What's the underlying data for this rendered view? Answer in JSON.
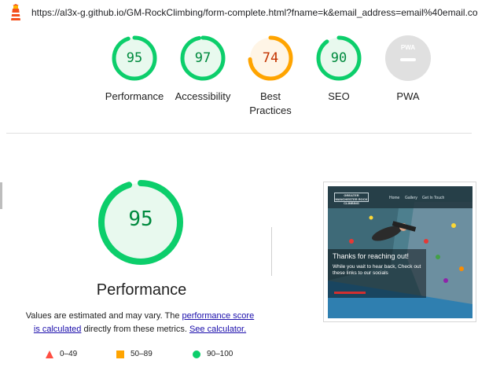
{
  "browser": {
    "url": "https://al3x-g.github.io/GM-RockClimbing/form-complete.html?fname=k&email_address=email%40email.com"
  },
  "categories": [
    {
      "key": "performance",
      "label": "Performance",
      "score": "95",
      "fraction": 0.95,
      "color": "#0cce6b",
      "text_color": "#008a3e",
      "fill": "#e8f9ee"
    },
    {
      "key": "accessibility",
      "label": "Accessibility",
      "score": "97",
      "fraction": 0.97,
      "color": "#0cce6b",
      "text_color": "#008a3e",
      "fill": "#e8f9ee"
    },
    {
      "key": "best-practices",
      "label_line1": "Best",
      "label_line2": "Practices",
      "score": "74",
      "fraction": 0.74,
      "color": "#ffa400",
      "text_color": "#c33300",
      "fill": "#fff5e6"
    },
    {
      "key": "seo",
      "label": "SEO",
      "score": "90",
      "fraction": 0.9,
      "color": "#0cce6b",
      "text_color": "#008a3e",
      "fill": "#e8f9ee"
    },
    {
      "key": "pwa",
      "label": "PWA",
      "badge": "PWA",
      "fill": "#e0e0e0"
    }
  ],
  "summary": {
    "score": "95",
    "fraction": 0.95,
    "title": "Performance",
    "note_prefix": "Values are estimated and may vary. The ",
    "link_score": "performance score is calculated",
    "note_middle": " directly from these metrics. ",
    "link_calculator": "See calculator."
  },
  "legend": [
    {
      "range": "0–49",
      "shape": "triangle",
      "color": "#ff4e42"
    },
    {
      "range": "50–89",
      "shape": "square",
      "color": "#ffa400"
    },
    {
      "range": "90–100",
      "shape": "circle",
      "color": "#0cce6b"
    }
  ],
  "screenshot": {
    "logo_text": "GREATER MANCHESTER ROCK CLIMBING",
    "nav_links": [
      "Home",
      "Gallery",
      "Get In Touch"
    ],
    "heading": "Thanks for reaching out!",
    "body": "While you wait to hear back, Check out these links to our socials"
  }
}
